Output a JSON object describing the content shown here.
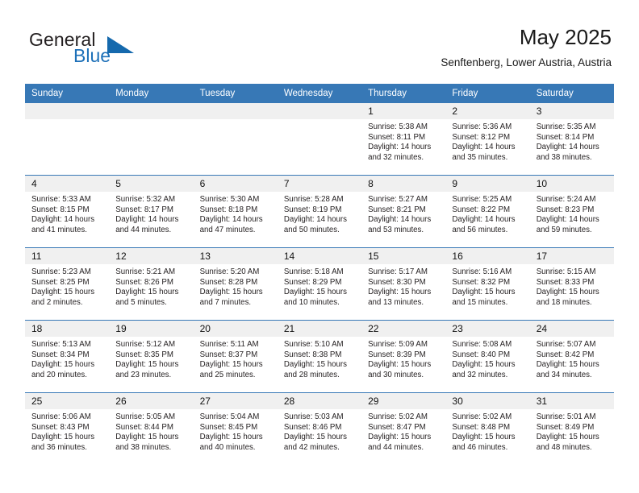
{
  "logo": {
    "word_one": "General",
    "word_two": "Blue",
    "triangle_color": "#1569ad",
    "blue_color": "#1d70b8"
  },
  "header": {
    "title": "May 2025",
    "location": "Senftenberg, Lower Austria, Austria"
  },
  "theme": {
    "header_blue": "#3778b6",
    "band_gray": "#f0f0f0",
    "text": "#231f20"
  },
  "weekday_headers": [
    "Sunday",
    "Monday",
    "Tuesday",
    "Wednesday",
    "Thursday",
    "Friday",
    "Saturday"
  ],
  "weeks": [
    [
      {
        "day": "",
        "sunrise": "",
        "sunset": "",
        "daylight_line1": "",
        "daylight_line2": ""
      },
      {
        "day": "",
        "sunrise": "",
        "sunset": "",
        "daylight_line1": "",
        "daylight_line2": ""
      },
      {
        "day": "",
        "sunrise": "",
        "sunset": "",
        "daylight_line1": "",
        "daylight_line2": ""
      },
      {
        "day": "",
        "sunrise": "",
        "sunset": "",
        "daylight_line1": "",
        "daylight_line2": ""
      },
      {
        "day": "1",
        "sunrise": "Sunrise: 5:38 AM",
        "sunset": "Sunset: 8:11 PM",
        "daylight_line1": "Daylight: 14 hours",
        "daylight_line2": "and 32 minutes."
      },
      {
        "day": "2",
        "sunrise": "Sunrise: 5:36 AM",
        "sunset": "Sunset: 8:12 PM",
        "daylight_line1": "Daylight: 14 hours",
        "daylight_line2": "and 35 minutes."
      },
      {
        "day": "3",
        "sunrise": "Sunrise: 5:35 AM",
        "sunset": "Sunset: 8:14 PM",
        "daylight_line1": "Daylight: 14 hours",
        "daylight_line2": "and 38 minutes."
      }
    ],
    [
      {
        "day": "4",
        "sunrise": "Sunrise: 5:33 AM",
        "sunset": "Sunset: 8:15 PM",
        "daylight_line1": "Daylight: 14 hours",
        "daylight_line2": "and 41 minutes."
      },
      {
        "day": "5",
        "sunrise": "Sunrise: 5:32 AM",
        "sunset": "Sunset: 8:17 PM",
        "daylight_line1": "Daylight: 14 hours",
        "daylight_line2": "and 44 minutes."
      },
      {
        "day": "6",
        "sunrise": "Sunrise: 5:30 AM",
        "sunset": "Sunset: 8:18 PM",
        "daylight_line1": "Daylight: 14 hours",
        "daylight_line2": "and 47 minutes."
      },
      {
        "day": "7",
        "sunrise": "Sunrise: 5:28 AM",
        "sunset": "Sunset: 8:19 PM",
        "daylight_line1": "Daylight: 14 hours",
        "daylight_line2": "and 50 minutes."
      },
      {
        "day": "8",
        "sunrise": "Sunrise: 5:27 AM",
        "sunset": "Sunset: 8:21 PM",
        "daylight_line1": "Daylight: 14 hours",
        "daylight_line2": "and 53 minutes."
      },
      {
        "day": "9",
        "sunrise": "Sunrise: 5:25 AM",
        "sunset": "Sunset: 8:22 PM",
        "daylight_line1": "Daylight: 14 hours",
        "daylight_line2": "and 56 minutes."
      },
      {
        "day": "10",
        "sunrise": "Sunrise: 5:24 AM",
        "sunset": "Sunset: 8:23 PM",
        "daylight_line1": "Daylight: 14 hours",
        "daylight_line2": "and 59 minutes."
      }
    ],
    [
      {
        "day": "11",
        "sunrise": "Sunrise: 5:23 AM",
        "sunset": "Sunset: 8:25 PM",
        "daylight_line1": "Daylight: 15 hours",
        "daylight_line2": "and 2 minutes."
      },
      {
        "day": "12",
        "sunrise": "Sunrise: 5:21 AM",
        "sunset": "Sunset: 8:26 PM",
        "daylight_line1": "Daylight: 15 hours",
        "daylight_line2": "and 5 minutes."
      },
      {
        "day": "13",
        "sunrise": "Sunrise: 5:20 AM",
        "sunset": "Sunset: 8:28 PM",
        "daylight_line1": "Daylight: 15 hours",
        "daylight_line2": "and 7 minutes."
      },
      {
        "day": "14",
        "sunrise": "Sunrise: 5:18 AM",
        "sunset": "Sunset: 8:29 PM",
        "daylight_line1": "Daylight: 15 hours",
        "daylight_line2": "and 10 minutes."
      },
      {
        "day": "15",
        "sunrise": "Sunrise: 5:17 AM",
        "sunset": "Sunset: 8:30 PM",
        "daylight_line1": "Daylight: 15 hours",
        "daylight_line2": "and 13 minutes."
      },
      {
        "day": "16",
        "sunrise": "Sunrise: 5:16 AM",
        "sunset": "Sunset: 8:32 PM",
        "daylight_line1": "Daylight: 15 hours",
        "daylight_line2": "and 15 minutes."
      },
      {
        "day": "17",
        "sunrise": "Sunrise: 5:15 AM",
        "sunset": "Sunset: 8:33 PM",
        "daylight_line1": "Daylight: 15 hours",
        "daylight_line2": "and 18 minutes."
      }
    ],
    [
      {
        "day": "18",
        "sunrise": "Sunrise: 5:13 AM",
        "sunset": "Sunset: 8:34 PM",
        "daylight_line1": "Daylight: 15 hours",
        "daylight_line2": "and 20 minutes."
      },
      {
        "day": "19",
        "sunrise": "Sunrise: 5:12 AM",
        "sunset": "Sunset: 8:35 PM",
        "daylight_line1": "Daylight: 15 hours",
        "daylight_line2": "and 23 minutes."
      },
      {
        "day": "20",
        "sunrise": "Sunrise: 5:11 AM",
        "sunset": "Sunset: 8:37 PM",
        "daylight_line1": "Daylight: 15 hours",
        "daylight_line2": "and 25 minutes."
      },
      {
        "day": "21",
        "sunrise": "Sunrise: 5:10 AM",
        "sunset": "Sunset: 8:38 PM",
        "daylight_line1": "Daylight: 15 hours",
        "daylight_line2": "and 28 minutes."
      },
      {
        "day": "22",
        "sunrise": "Sunrise: 5:09 AM",
        "sunset": "Sunset: 8:39 PM",
        "daylight_line1": "Daylight: 15 hours",
        "daylight_line2": "and 30 minutes."
      },
      {
        "day": "23",
        "sunrise": "Sunrise: 5:08 AM",
        "sunset": "Sunset: 8:40 PM",
        "daylight_line1": "Daylight: 15 hours",
        "daylight_line2": "and 32 minutes."
      },
      {
        "day": "24",
        "sunrise": "Sunrise: 5:07 AM",
        "sunset": "Sunset: 8:42 PM",
        "daylight_line1": "Daylight: 15 hours",
        "daylight_line2": "and 34 minutes."
      }
    ],
    [
      {
        "day": "25",
        "sunrise": "Sunrise: 5:06 AM",
        "sunset": "Sunset: 8:43 PM",
        "daylight_line1": "Daylight: 15 hours",
        "daylight_line2": "and 36 minutes."
      },
      {
        "day": "26",
        "sunrise": "Sunrise: 5:05 AM",
        "sunset": "Sunset: 8:44 PM",
        "daylight_line1": "Daylight: 15 hours",
        "daylight_line2": "and 38 minutes."
      },
      {
        "day": "27",
        "sunrise": "Sunrise: 5:04 AM",
        "sunset": "Sunset: 8:45 PM",
        "daylight_line1": "Daylight: 15 hours",
        "daylight_line2": "and 40 minutes."
      },
      {
        "day": "28",
        "sunrise": "Sunrise: 5:03 AM",
        "sunset": "Sunset: 8:46 PM",
        "daylight_line1": "Daylight: 15 hours",
        "daylight_line2": "and 42 minutes."
      },
      {
        "day": "29",
        "sunrise": "Sunrise: 5:02 AM",
        "sunset": "Sunset: 8:47 PM",
        "daylight_line1": "Daylight: 15 hours",
        "daylight_line2": "and 44 minutes."
      },
      {
        "day": "30",
        "sunrise": "Sunrise: 5:02 AM",
        "sunset": "Sunset: 8:48 PM",
        "daylight_line1": "Daylight: 15 hours",
        "daylight_line2": "and 46 minutes."
      },
      {
        "day": "31",
        "sunrise": "Sunrise: 5:01 AM",
        "sunset": "Sunset: 8:49 PM",
        "daylight_line1": "Daylight: 15 hours",
        "daylight_line2": "and 48 minutes."
      }
    ]
  ]
}
